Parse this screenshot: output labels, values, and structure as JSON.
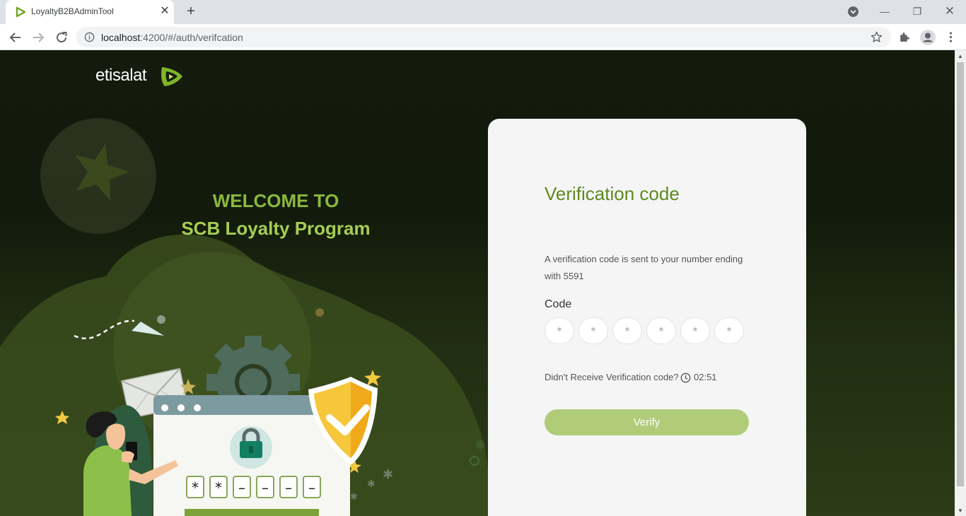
{
  "browser": {
    "tab_title": "LoyaltyB2BAdminTool",
    "url_host": "localhost",
    "url_path": ":4200/#/auth/verifcation"
  },
  "brand": {
    "logo_text": "etisalat",
    "accent_color": "#5e8a1f",
    "button_color": "#b0cc78"
  },
  "hero": {
    "welcome_line1": "WELCOME TO",
    "welcome_line2": "SCB Loyalty Program",
    "code_mask_chars": [
      "*",
      "*",
      "–",
      "–",
      "–",
      "–"
    ]
  },
  "card": {
    "title": "Verification code",
    "description": "A verification code is sent to your number ending with 5591",
    "code_label": "Code",
    "code_placeholders": [
      "*",
      "*",
      "*",
      "*",
      "*",
      "*"
    ],
    "resend_text": "Didn't Receive Verification code?",
    "timer": "02:51",
    "verify_label": "Verify"
  }
}
